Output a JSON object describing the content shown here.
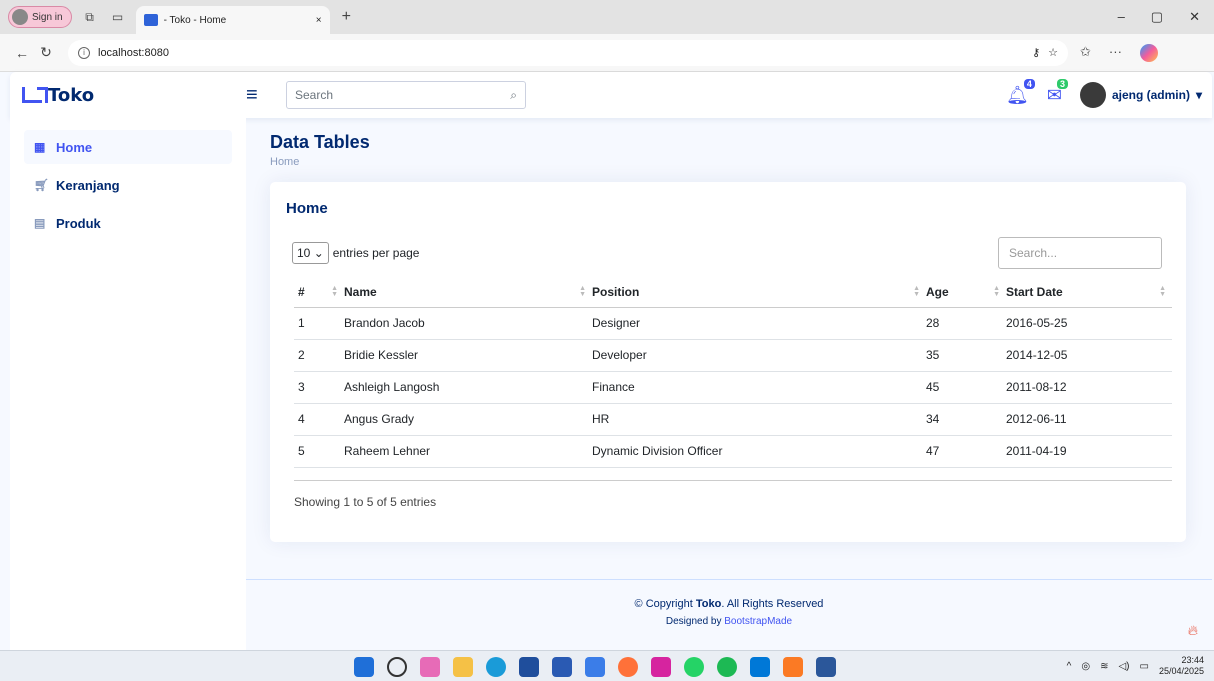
{
  "browser": {
    "signin_label": "Sign in",
    "tab_title": "- Toko - Home",
    "url": "localhost:8080",
    "new_tab_label": "+",
    "tab_close": "×"
  },
  "header": {
    "brand": "Toko",
    "search_placeholder": "Search",
    "notif_count": "4",
    "message_count": "3",
    "user_name": "ajeng (admin)",
    "notif_badge_color": "#4154f1",
    "message_badge_color": "#2eca6a"
  },
  "sidebar": {
    "items": [
      {
        "label": "Home",
        "icon": "grid-icon"
      },
      {
        "label": "Keranjang",
        "icon": "cart-icon"
      },
      {
        "label": "Produk",
        "icon": "list-icon"
      }
    ]
  },
  "page": {
    "title": "Data Tables",
    "breadcrumb": "Home"
  },
  "card": {
    "title": "Home",
    "per_page_value": "10",
    "per_page_label": "entries per page",
    "search_placeholder": "Search...",
    "columns": [
      "#",
      "Name",
      "Position",
      "Age",
      "Start Date"
    ],
    "rows": [
      [
        "1",
        "Brandon Jacob",
        "Designer",
        "28",
        "2016-05-25"
      ],
      [
        "2",
        "Bridie Kessler",
        "Developer",
        "35",
        "2014-12-05"
      ],
      [
        "3",
        "Ashleigh Langosh",
        "Finance",
        "45",
        "2011-08-12"
      ],
      [
        "4",
        "Angus Grady",
        "HR",
        "34",
        "2012-06-11"
      ],
      [
        "5",
        "Raheem Lehner",
        "Dynamic Division Officer",
        "47",
        "2011-04-19"
      ]
    ],
    "info": "Showing 1 to 5 of 5 entries"
  },
  "footer": {
    "copyright_prefix": "© Copyright",
    "copyright_brand": "Toko",
    "copyright_suffix": ". All Rights Reserved",
    "designed_by": "Designed by",
    "designer": "BootstrapMade"
  },
  "taskbar": {
    "time": "23:44",
    "date": "25/04/2025"
  }
}
